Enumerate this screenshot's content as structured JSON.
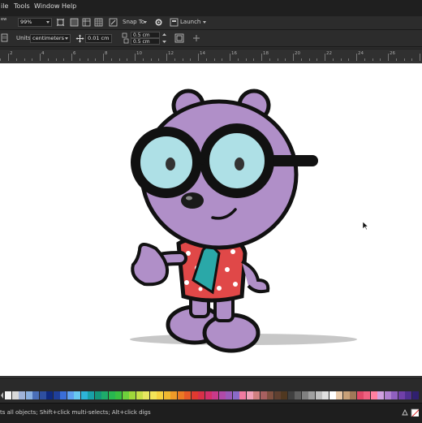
{
  "menu": {
    "file_partial": "ile",
    "tools": "Tools",
    "window": "Window",
    "help": "Help"
  },
  "toolbar1": {
    "zoom_partial": "ew",
    "zoom_value": "99%",
    "snap_to": "Snap To",
    "launch": "Launch"
  },
  "toolbar2": {
    "units_label": "Units:",
    "units_value": "centimeters",
    "nudge_value": "0.01 cm",
    "dup_x": "0.5 cm",
    "dup_y": "0.5 cm"
  },
  "ruler": {
    "labels": [
      "2",
      "4",
      "6",
      "8",
      "10",
      "12",
      "14",
      "16",
      "18",
      "20",
      "22",
      "24",
      "26"
    ]
  },
  "palette": {
    "colors": [
      "#f2f2f2",
      "#d9d9d9",
      "#9fb3d9",
      "#8ab0e0",
      "#4a6fb8",
      "#2e4fa0",
      "#0f2a80",
      "#1f3f9a",
      "#3a6ed8",
      "#5fa0f0",
      "#68c8f0",
      "#2db4d8",
      "#19a0a8",
      "#14967a",
      "#1eab6a",
      "#28b850",
      "#39c040",
      "#6ed03c",
      "#9fd83a",
      "#c8e048",
      "#e8e860",
      "#f2e458",
      "#f5d240",
      "#f0b830",
      "#f09a28",
      "#ec7a24",
      "#e85a28",
      "#e03a30",
      "#d83048",
      "#d4306a",
      "#c83a8a",
      "#b04aa8",
      "#9a5ab8",
      "#8a6ac8",
      "#f07aa0",
      "#f0a0b8",
      "#d08080",
      "#a86060",
      "#805040",
      "#604030",
      "#503820",
      "#404040",
      "#606060",
      "#808080",
      "#a0a0a0",
      "#c0c0c0",
      "#e0e0e0",
      "#ffffff",
      "#e8c8a8",
      "#c8a078",
      "#a07858",
      "#e04868",
      "#f06080",
      "#ff80a0",
      "#d0a0e0",
      "#b080d0",
      "#9060c0",
      "#7040a8",
      "#503090",
      "#302070"
    ]
  },
  "status": {
    "text": "ts all objects; Shift+click multi-selects; Alt+click digs"
  },
  "colors": {
    "character_fill": "#b08fc8",
    "outline": "#111111",
    "lens": "#aee0e6",
    "shirt": "#e04848",
    "tie": "#2aa8a8"
  }
}
